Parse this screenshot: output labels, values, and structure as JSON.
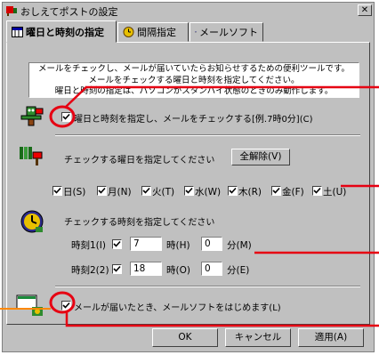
{
  "window": {
    "title": "おしえてポストの設定",
    "close_glyph": "✕"
  },
  "tabs": [
    {
      "label": "曜日と時刻の指定"
    },
    {
      "label": "間隔指定"
    },
    {
      "label": "メールソフト"
    }
  ],
  "description": {
    "line1": "メールをチェックし、メールが届いていたらお知らせするための便利ツールです。",
    "line2": "メールをチェックする曜日と時刻を指定してください。",
    "line3": "曜日と時刻の指定は、パソコンがスタンバイ状態のときのみ動作します。"
  },
  "enable_schedule": {
    "label": "曜日と時刻を指定し、メールをチェックする[例.7時0分](C)",
    "checked": true
  },
  "days_section": {
    "heading": "チェックする曜日を指定してください",
    "clear_all_label": "全解除(V)"
  },
  "days": [
    {
      "label": "日(S)",
      "checked": true
    },
    {
      "label": "月(N)",
      "checked": true
    },
    {
      "label": "火(T)",
      "checked": true
    },
    {
      "label": "水(W)",
      "checked": true
    },
    {
      "label": "木(R)",
      "checked": true
    },
    {
      "label": "金(F)",
      "checked": true
    },
    {
      "label": "土(U)",
      "checked": true
    }
  ],
  "times_section": {
    "heading": "チェックする時刻を指定してください"
  },
  "times": [
    {
      "label": "時刻1(I)",
      "checked": true,
      "hour": "7",
      "hour_label": "時(H)",
      "minute": "0",
      "minute_label": "分(M)"
    },
    {
      "label": "時刻2(2)",
      "checked": true,
      "hour": "18",
      "hour_label": "時(O)",
      "minute": "0",
      "minute_label": "分(E)"
    }
  ],
  "launch_mailer": {
    "label": "メールが届いたとき、メールソフトをはじめます(L)",
    "checked": true
  },
  "buttons": {
    "ok": "OK",
    "cancel": "キャンセル",
    "apply": "適用(A)"
  },
  "colors": {
    "annotation": "#e60012",
    "annotation_line": "#ff8800"
  }
}
